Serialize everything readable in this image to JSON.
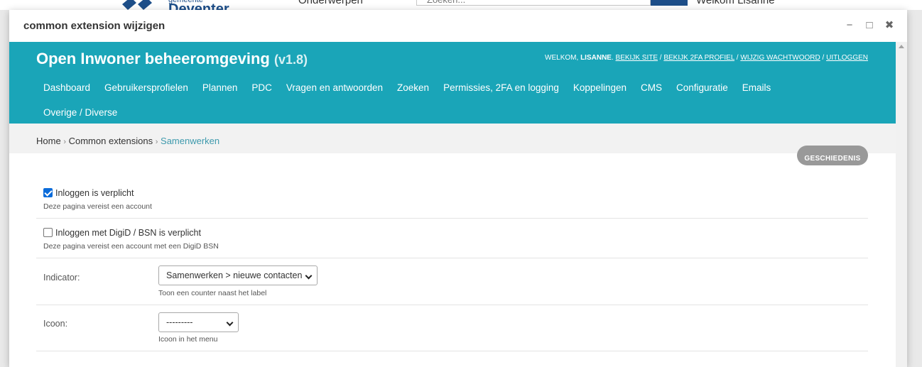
{
  "background_page": {
    "brand_small": "gemeente",
    "brand_name": "Deventer",
    "nav_label": "Onderwerpen",
    "search_placeholder": "Zoeken...",
    "welcome_text": "Welkom Lisanne"
  },
  "dialog": {
    "title": "common extension wijzigen",
    "minimize_label": "−",
    "maximize_label": "□",
    "close_label": "✖"
  },
  "header": {
    "site_title": "Open Inwoner beheeromgeving",
    "version": "(v1.8)",
    "welcome_prefix": "WELKOM,",
    "username": "LISANNE",
    "links": [
      "BEKIJK SITE",
      "BEKIJK 2FA PROFIEL",
      "WIJZIG WACHTWOORD",
      "UITLOGGEN"
    ],
    "link_separator": "/"
  },
  "nav": {
    "items": [
      "Dashboard",
      "Gebruikersprofielen",
      "Plannen",
      "PDC",
      "Vragen en antwoorden",
      "Zoeken",
      "Permissies, 2FA en logging",
      "Koppelingen",
      "CMS",
      "Configuratie",
      "Emails",
      "Overige / Diverse"
    ]
  },
  "breadcrumbs": {
    "items": [
      "Home",
      "Common extensions"
    ],
    "current": "Samenwerken",
    "separator": "›"
  },
  "history_button": {
    "label": "GESCHIEDENIS"
  },
  "form": {
    "login_required": {
      "label": "Inloggen is verplicht",
      "checked": true,
      "help": "Deze pagina vereist een account"
    },
    "digid_required": {
      "label": "Inloggen met DigiD / BSN is verplicht",
      "checked": false,
      "help": "Deze pagina vereist een account met een DigiD BSN"
    },
    "indicator": {
      "label": "Indicator:",
      "selected": "Samenwerken > nieuwe contacten",
      "help": "Toon een counter naast het label"
    },
    "icon": {
      "label": "Icoon:",
      "selected": "---------",
      "help": "Icoon in het menu"
    }
  },
  "colors": {
    "header_teal": "#1aa5b8",
    "checkbox_blue": "#0b6cda",
    "breadcrumb_current": "#3e9aad",
    "history_gray": "#999999"
  }
}
